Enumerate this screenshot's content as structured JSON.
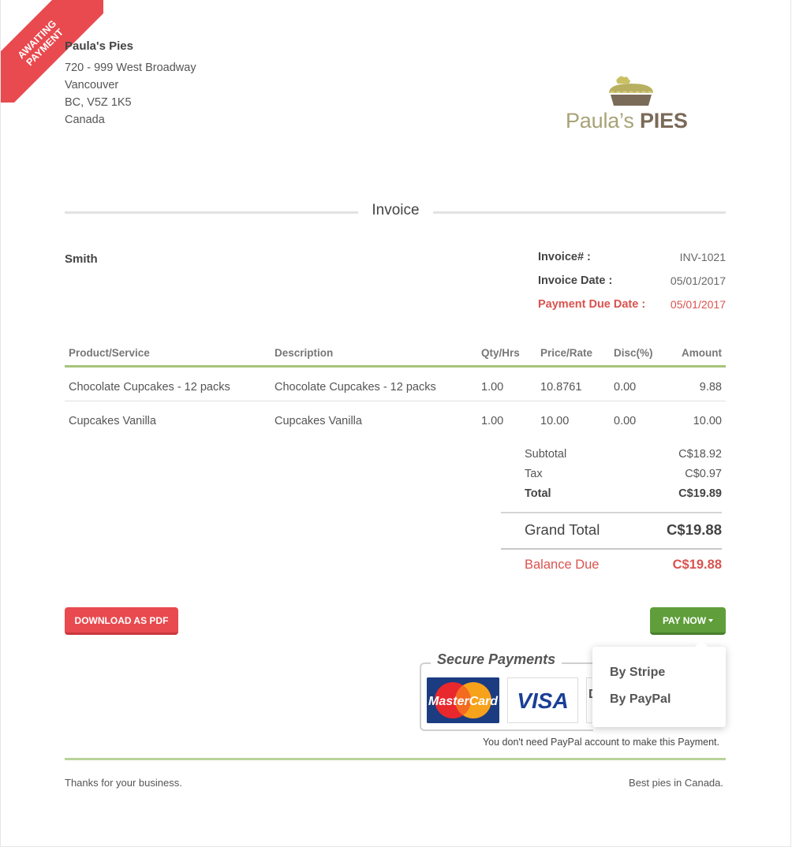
{
  "status_ribbon": {
    "line1": "AWAITING",
    "line2": "PAYMENT"
  },
  "company": {
    "name": "Paula's Pies",
    "address": [
      "720 - 999 West Broadway",
      "Vancouver",
      "BC, V5Z 1K5",
      "Canada"
    ]
  },
  "logo": {
    "part1": "Paula’s ",
    "part2": "PIES",
    "colors": {
      "text": "#a8a277",
      "accent": "#7a6a58"
    }
  },
  "document_title": "Invoice",
  "client": "Smith",
  "meta": {
    "invoice_no_label": "Invoice# :",
    "invoice_no": "INV-1021",
    "invoice_date_label": "Invoice Date :",
    "invoice_date": "05/01/2017",
    "due_date_label": "Payment Due Date :",
    "due_date": "05/01/2017"
  },
  "table": {
    "headers": [
      "Product/Service",
      "Description",
      "Qty/Hrs",
      "Price/Rate",
      "Disc(%)",
      "Amount"
    ],
    "rows": [
      [
        "Chocolate Cupcakes - 12 packs",
        "Chocolate Cupcakes - 12 packs",
        "1.00",
        "10.8761",
        "0.00",
        "9.88"
      ],
      [
        "Cupcakes Vanilla",
        "Cupcakes Vanilla",
        "1.00",
        "10.00",
        "0.00",
        "10.00"
      ]
    ]
  },
  "totals": {
    "subtotal_label": "Subtotal",
    "subtotal": "C$18.92",
    "tax_label": "Tax",
    "tax": "C$0.97",
    "total_label": "Total",
    "total": "C$19.89",
    "grand_total_label": "Grand Total",
    "grand_total": "C$19.88",
    "balance_due_label": "Balance Due",
    "balance_due": "C$19.88"
  },
  "buttons": {
    "download_pdf": "DOWNLOAD AS PDF",
    "pay_now": "PAY NOW"
  },
  "pay_menu": [
    "By Stripe",
    "By PayPal"
  ],
  "secure_payments": {
    "title": "Secure Payments",
    "cards": [
      "MasterCard",
      "VISA"
    ],
    "note": "You don't need PayPal account to make this Payment."
  },
  "footer": {
    "left": "Thanks for your business.",
    "right": "Best pies in Canada."
  },
  "colors": {
    "red": "#e84a4f",
    "green": "#5f9e3a",
    "rule_green": "#a6c47a",
    "due_red": "#d9534f"
  }
}
